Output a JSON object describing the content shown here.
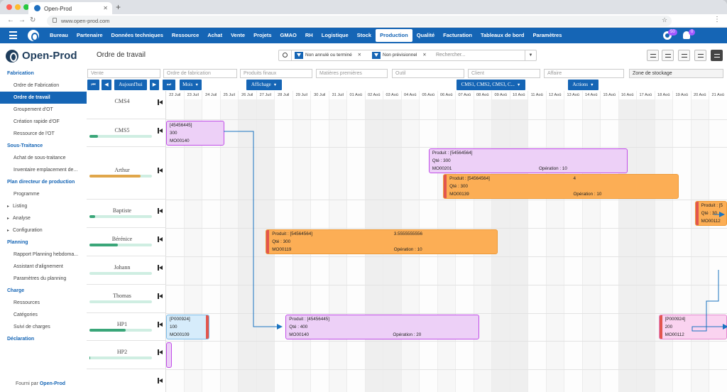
{
  "browser": {
    "tab_title": "Open-Prod",
    "url": "www.open-prod.com",
    "traffic_lights": [
      "#ff5f57",
      "#febc2e",
      "#28c840"
    ]
  },
  "topnav": {
    "items": [
      "Bureau",
      "Partenaire",
      "Données techniques",
      "Ressource",
      "Achat",
      "Vente",
      "Projets",
      "GMAO",
      "RH",
      "Logistique",
      "Stock",
      "Production",
      "Qualité",
      "Facturation",
      "Tableaux de bord",
      "Paramètres"
    ],
    "active": "Production",
    "settings_badge": "50",
    "notif_badge": "0"
  },
  "brand": {
    "name": "Open-Prod"
  },
  "sidebar": [
    {
      "type": "section",
      "label": "Fabrication"
    },
    {
      "type": "item",
      "label": "Ordre de Fabrication"
    },
    {
      "type": "item",
      "label": "Ordre de travail",
      "active": true
    },
    {
      "type": "item",
      "label": "Groupement d'OT"
    },
    {
      "type": "item",
      "label": "Création rapide d'OF"
    },
    {
      "type": "item",
      "label": "Ressource de l'OT"
    },
    {
      "type": "section",
      "label": "Sous-Traitance"
    },
    {
      "type": "item",
      "label": "Achat de sous-traitance"
    },
    {
      "type": "item",
      "label": "Inventaire emplacement de..."
    },
    {
      "type": "section",
      "label": "Plan directeur de production"
    },
    {
      "type": "item",
      "label": "Programme"
    },
    {
      "type": "item",
      "label": "Listing",
      "arrow": true
    },
    {
      "type": "item",
      "label": "Analyse",
      "arrow": true
    },
    {
      "type": "item",
      "label": "Configuration",
      "arrow": true
    },
    {
      "type": "section",
      "label": "Planning"
    },
    {
      "type": "item",
      "label": "Rapport Planning hebdoma..."
    },
    {
      "type": "item",
      "label": "Assistant d'alignement"
    },
    {
      "type": "item",
      "label": "Paramètres du planning"
    },
    {
      "type": "section",
      "label": "Charge"
    },
    {
      "type": "item",
      "label": "Ressources"
    },
    {
      "type": "item",
      "label": "Catégories"
    },
    {
      "type": "item",
      "label": "Suivi de charges"
    },
    {
      "type": "section",
      "label": "Déclaration"
    },
    {
      "type": "item",
      "label": ""
    }
  ],
  "footer": {
    "prefix": "Fourni par",
    "brand": "Open-Prod"
  },
  "page": {
    "title": "Ordre de travail"
  },
  "search": {
    "chips": [
      "Non annulé ou terminé",
      "Non prévisionnel"
    ],
    "placeholder": "Rechercher..."
  },
  "column_filters": [
    "Vente",
    "Ordre de fabrication",
    "Produits finaux",
    "Matières premières",
    "Outil",
    "Client",
    "Affaire",
    "Zone de stockage"
  ],
  "toolbar": {
    "today": "Aujourd'hui",
    "scale": "Mois",
    "display": "Affichage",
    "resources_filter": "CMS1, CMS2, CMS3, C...",
    "actions": "Actions"
  },
  "timeline": {
    "days": [
      "22 Juil",
      "23 Juil",
      "24 Juil",
      "25 Juil",
      "26 Juil",
      "27 Juil",
      "28 Juil",
      "29 Juil",
      "30 Juil",
      "31 Juil",
      "01 Aoû",
      "02 Aoû",
      "03 Aoû",
      "04 Aoû",
      "05 Aoû",
      "06 Aoû",
      "07 Aoû",
      "08 Aoû",
      "09 Aoû",
      "10 Aoû",
      "11 Aoû",
      "12 Aoû",
      "13 Aoû",
      "14 Aoû",
      "15 Aoû",
      "16 Aoû",
      "17 Aoû",
      "18 Aoû",
      "19 Aoû",
      "20 Aoû",
      "21 Aoû"
    ],
    "weekend_days": [
      4,
      5,
      11,
      12,
      18,
      19,
      25,
      26
    ]
  },
  "resources": [
    {
      "name": "CMS4",
      "load": null,
      "pct": ""
    },
    {
      "name": "CMS5",
      "load": 0.14,
      "pct": "",
      "color": "#3aa679"
    },
    {
      "name": "Arthur",
      "load": 0.82,
      "pct": "",
      "color": "#e0a64a"
    },
    {
      "name": "Baptiste",
      "load": 0.09,
      "pct": "",
      "color": "#3aa679"
    },
    {
      "name": "Bérénice",
      "load": 0.45,
      "pct": "",
      "color": "#3aa679"
    },
    {
      "name": "Johann",
      "load": 0,
      "pct": "",
      "color": "#3aa679"
    },
    {
      "name": "Thomas",
      "load": 0,
      "pct": "",
      "color": "#3aa679"
    },
    {
      "name": "HP1",
      "load": 0.58,
      "pct": "",
      "color": "#3aa679"
    },
    {
      "name": "HP2",
      "load": 0.01,
      "pct": "",
      "color": "#3aa679"
    },
    {
      "name": "",
      "load": null,
      "pct": ""
    }
  ],
  "tasks": [
    {
      "row": 1,
      "start": 0.0,
      "end": 3.2,
      "variant": "violet",
      "lines": [
        "[45456445]",
        "300",
        "MO00140"
      ]
    },
    {
      "row": 2,
      "start": 14.5,
      "end": 25.5,
      "variant": "violet",
      "lines": [
        "Produit : [54564564]",
        "Qté : 300",
        "MO00201"
      ],
      "op": "Opération : 10"
    },
    {
      "row": 2,
      "start": 15.3,
      "end": 28.3,
      "variant": "orange",
      "lines": [
        "Produit : [54564564]",
        "Qté : 300",
        "MO00139"
      ],
      "op": "Opération : 10",
      "extra": "4"
    },
    {
      "row": 3,
      "start": 29.2,
      "end": 31.0,
      "variant": "orange",
      "lines": [
        "Produit : [5",
        "Qté : 30",
        "MO00112"
      ]
    },
    {
      "row": 4,
      "start": 5.5,
      "end": 18.3,
      "variant": "orange",
      "lines": [
        "Produit : [54564564]",
        "Qté : 300",
        "MO00119"
      ],
      "op": "Opération : 10",
      "extra": "3.5555555556"
    },
    {
      "row": 7,
      "start": 0.0,
      "end": 2.4,
      "variant": "blue",
      "lines": [
        "[P000924]",
        "100",
        "MO00109"
      ]
    },
    {
      "row": 7,
      "start": 6.6,
      "end": 17.3,
      "variant": "violet",
      "lines": [
        "Produit : [45456445]",
        "Qté : 400",
        "MO00140"
      ],
      "op": "Opération : 20"
    },
    {
      "row": 7,
      "start": 27.2,
      "end": 31.0,
      "variant": "pink",
      "lines": [
        "[P000924]",
        "200",
        "MO00112"
      ]
    },
    {
      "row": 8,
      "start": 0.0,
      "end": 0.3,
      "variant": "violet",
      "lines": []
    }
  ],
  "palette": {
    "primary": "#1565b5",
    "violet_bg": "#edd0f7",
    "violet_border": "#c14ee8",
    "orange_bg": "#fcae55",
    "orange_border": "#ee9a38",
    "blue_bg": "#d6ecfb",
    "blue_border": "#7fbde8",
    "pink_bg": "#fad3f0",
    "pink_border": "#e38ad0",
    "accent_red": "#e2564e",
    "arrow": "#1a73c0"
  }
}
